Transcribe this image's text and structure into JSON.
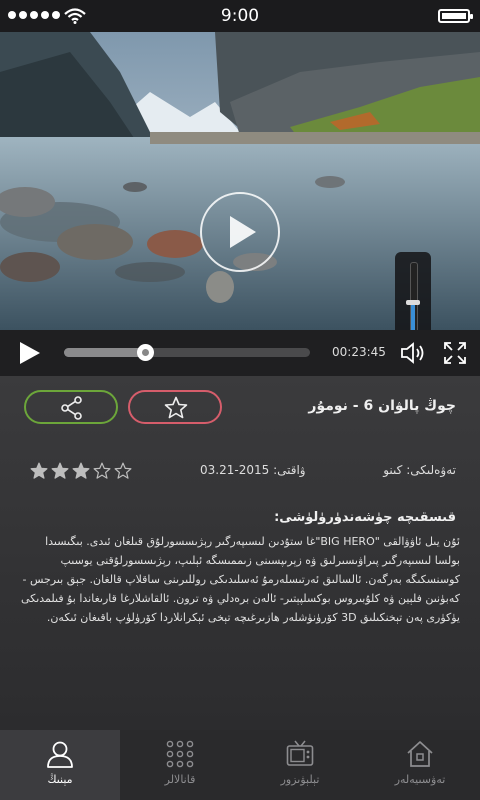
{
  "status_bar": {
    "time": "9:00"
  },
  "player": {
    "progress": 0.33,
    "volume": 0.5,
    "timecode": "00:23:45"
  },
  "movie": {
    "title": "چوڭ پالۋان 6 - نومۇر",
    "category": "تەۋەلىكى: كىنو",
    "date": "ۋاقتى: 2015-03.21",
    "rating": 3,
    "rating_max": 5,
    "description_title": "قىسقىچە چۈشەندۈرۈلۈشى:",
    "description": "ئۇن يىل ئاۋۋالقى \"BIG HERO\"غا ستۇدىن لىسىپەرگىر رېژىسسورلۇق قىلغان ئىدى. بىگىسىدا بولسا لىسىپەرگىر پىراۋىسىرلىق ۋە زېرىپسىنى زىممىسگە ئېلىپ، رېژىسسورلۇقنى يوسىپ كوسنسكىگە بەرگەن. ئالسالىق ئەرتىسلەرمۇ ئەسلىدىكى روللىرىنى ساقلاپ قالغان. جېق بىرجس - كەبۈنىن فلېين ۋە كلۇبىروس بوكسلپېتىر- ئالەن برەدلي ۋە ترون. ئالقاشلارغا قارىغاندا بۇ فىلمدىكى يۈكۈرى پەن تېخنكىلىق 3D كۆرۈنۈشلەر ھازىرغىچە تېخى ئېكرانلاردا كۆرۈلۈپ باقىغان ئىكەن."
  },
  "tabs": [
    {
      "label": "مېنىڭ",
      "icon": "user-icon",
      "active": true
    },
    {
      "label": "قانالالر",
      "icon": "grid-icon",
      "active": false
    },
    {
      "label": "تېلېۋىزور",
      "icon": "tv-icon",
      "active": false
    },
    {
      "label": "تەۋسىيەلەر",
      "icon": "home-icon",
      "active": false
    }
  ],
  "colors": {
    "share_border": "#6ca63a",
    "favorite_border": "#d65d6b",
    "volume_level": "#3a8fd6"
  }
}
